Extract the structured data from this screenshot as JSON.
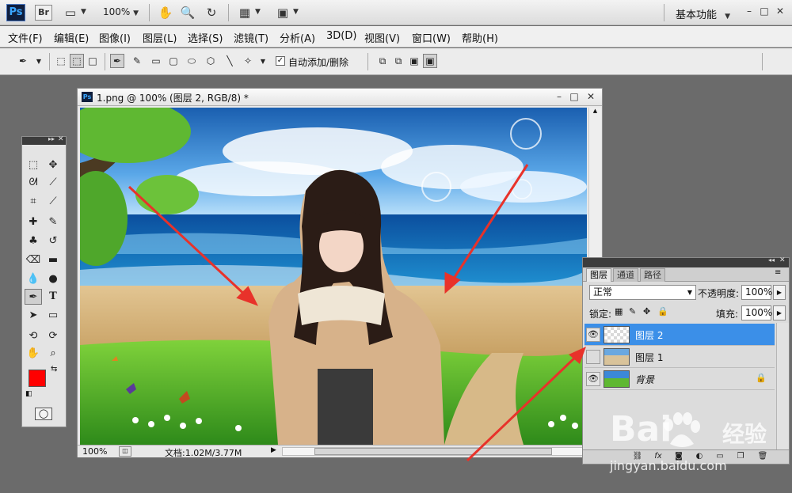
{
  "app": {
    "logo": "Ps",
    "bridge": "Br",
    "zoom": "100%",
    "workspace": "基本功能"
  },
  "menu": [
    "文件(F)",
    "编辑(E)",
    "图像(I)",
    "图层(L)",
    "选择(S)",
    "滤镜(T)",
    "分析(A)",
    "3D(D)",
    "视图(V)",
    "窗口(W)",
    "帮助(H)"
  ],
  "options": {
    "auto_add_delete": "自动添加/删除",
    "auto_add_checked": true
  },
  "document": {
    "title": "1.png @ 100% (图层 2, RGB/8) *",
    "zoom": "100%",
    "doc_info": "文档:1.02M/3.77M"
  },
  "colors": {
    "foreground": "#ff0000",
    "background": "#000000",
    "active_layer": "#3b8fe8",
    "annotation_arrows": "#e8322a"
  },
  "layers_panel": {
    "tabs": [
      "图层",
      "通道",
      "路径"
    ],
    "active_tab": 0,
    "blend_mode": "正常",
    "opacity_label": "不透明度:",
    "opacity": "100%",
    "lock_label": "锁定:",
    "fill_label": "填充:",
    "fill": "100%",
    "layers": [
      {
        "name": "图层 2",
        "visible": true,
        "active": true,
        "locked": false
      },
      {
        "name": "图层 1",
        "visible": false,
        "active": false,
        "locked": false
      },
      {
        "name": "背景",
        "visible": true,
        "active": false,
        "locked": true
      }
    ]
  },
  "watermark": {
    "brand": "Bai",
    "brand_suffix": "经验",
    "url": "jingyan.baidu.com"
  }
}
